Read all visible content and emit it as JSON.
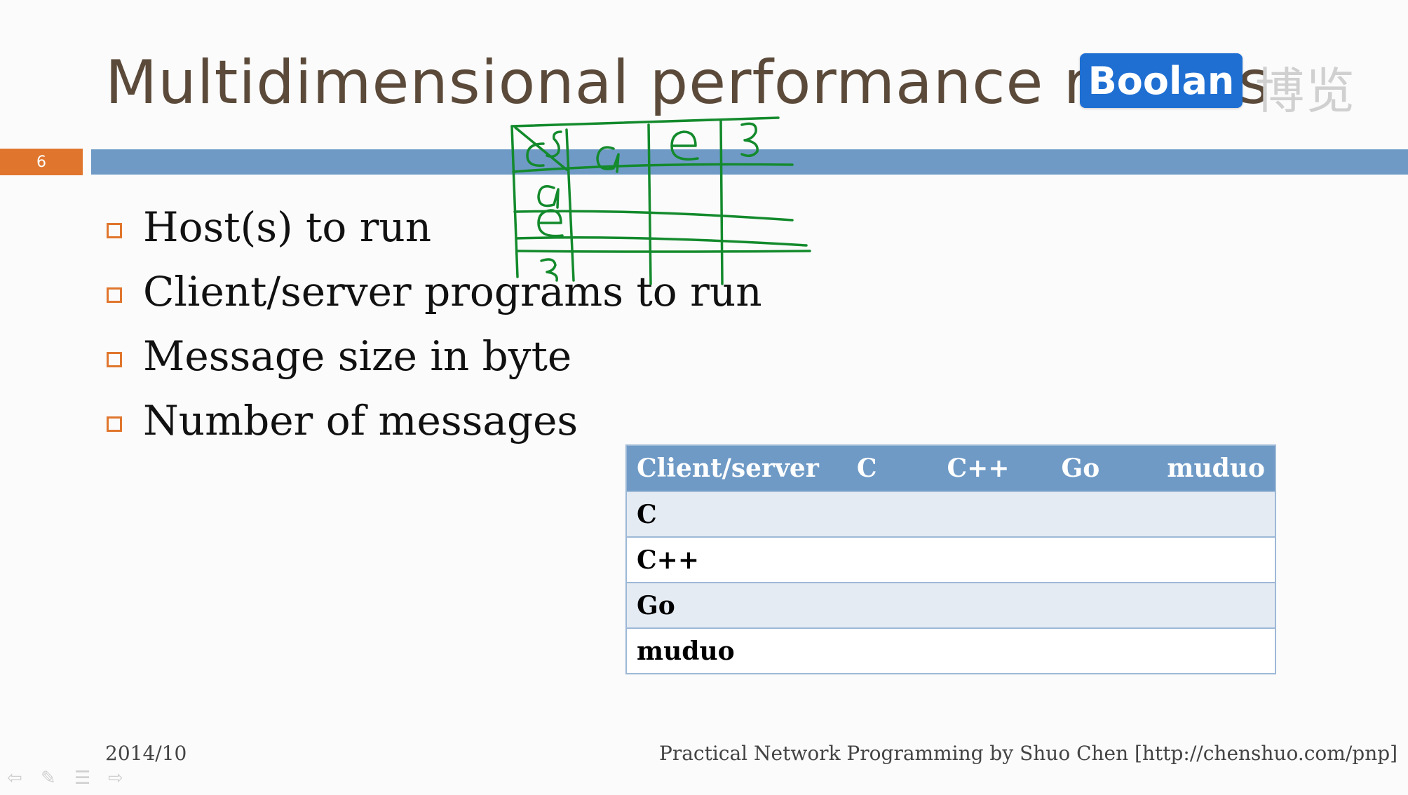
{
  "slide": {
    "title": "Multidimensional performance results",
    "page_number": "6",
    "bullets": [
      "Host(s) to run",
      "Client/server programs to run",
      "Message size in byte",
      "Number of messages"
    ],
    "table": {
      "header": [
        "Client/server",
        "C",
        "C++",
        "Go",
        "muduo"
      ],
      "rows": [
        "C",
        "C++",
        "Go",
        "muduo"
      ]
    },
    "footer_date": "2014/10",
    "footer_credit": "Practical Network Programming by Shuo Chen [http://chenshuo.com/pnp]"
  },
  "logo": {
    "brand": "Boolan",
    "brand_cn": "博览"
  },
  "annotation": {
    "labels": [
      "c\\s",
      "a",
      "e",
      "3"
    ]
  },
  "colors": {
    "accent_orange": "#e0762d",
    "bar_blue": "#6f9ac6",
    "ink_green": "#138a2c",
    "logo_blue": "#1f6fd3"
  },
  "nav_icons": [
    "back-arrow-icon",
    "pen-icon",
    "menu-icon",
    "forward-arrow-icon"
  ]
}
